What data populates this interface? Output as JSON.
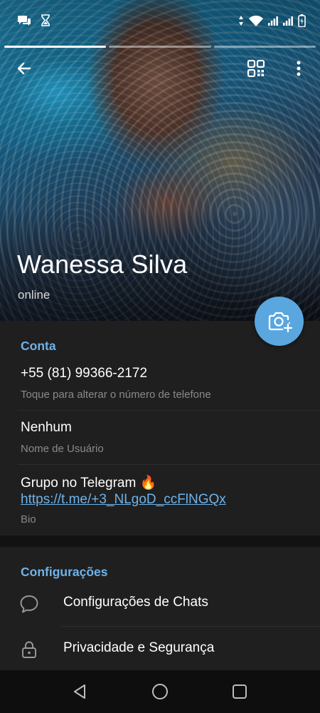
{
  "status_bar": {
    "left_icons": [
      "chat-notification-icon",
      "hourglass-icon"
    ],
    "right_icons": [
      "data-arrows-icon",
      "wifi-icon",
      "signal-icon",
      "signal-icon",
      "battery-charging-icon"
    ]
  },
  "story": {
    "bars": 3,
    "active_index": 0
  },
  "toolbar": {
    "back_icon": "arrow-left-icon",
    "qr_icon": "qr-code-icon",
    "more_icon": "more-vertical-icon"
  },
  "profile": {
    "name": "Wanessa Silva",
    "status": "online",
    "camera_icon": "camera-add-icon"
  },
  "account": {
    "title": "Conta",
    "phone": "+55 (81) 99366-2172",
    "phone_hint": "Toque para alterar o número de telefone",
    "username": "Nenhum",
    "username_hint": "Nome de Usuário",
    "bio_text": "Grupo no Telegram 🔥",
    "bio_link": "https://t.me/+3_NLgoD_ccFlNGQx",
    "bio_hint": "Bio"
  },
  "settings": {
    "title": "Configurações",
    "items": [
      {
        "label": "Configurações de Chats",
        "icon": "chat-bubble-icon"
      },
      {
        "label": "Privacidade e Segurança",
        "icon": "lock-icon"
      }
    ]
  },
  "nav": {
    "back": "nav-back-icon",
    "home": "nav-home-icon",
    "recents": "nav-recents-icon"
  },
  "colors": {
    "accent": "#6eb3ea",
    "fab": "#5aa6df",
    "background": "#1f1f1f",
    "hint": "#8a8a8a"
  }
}
